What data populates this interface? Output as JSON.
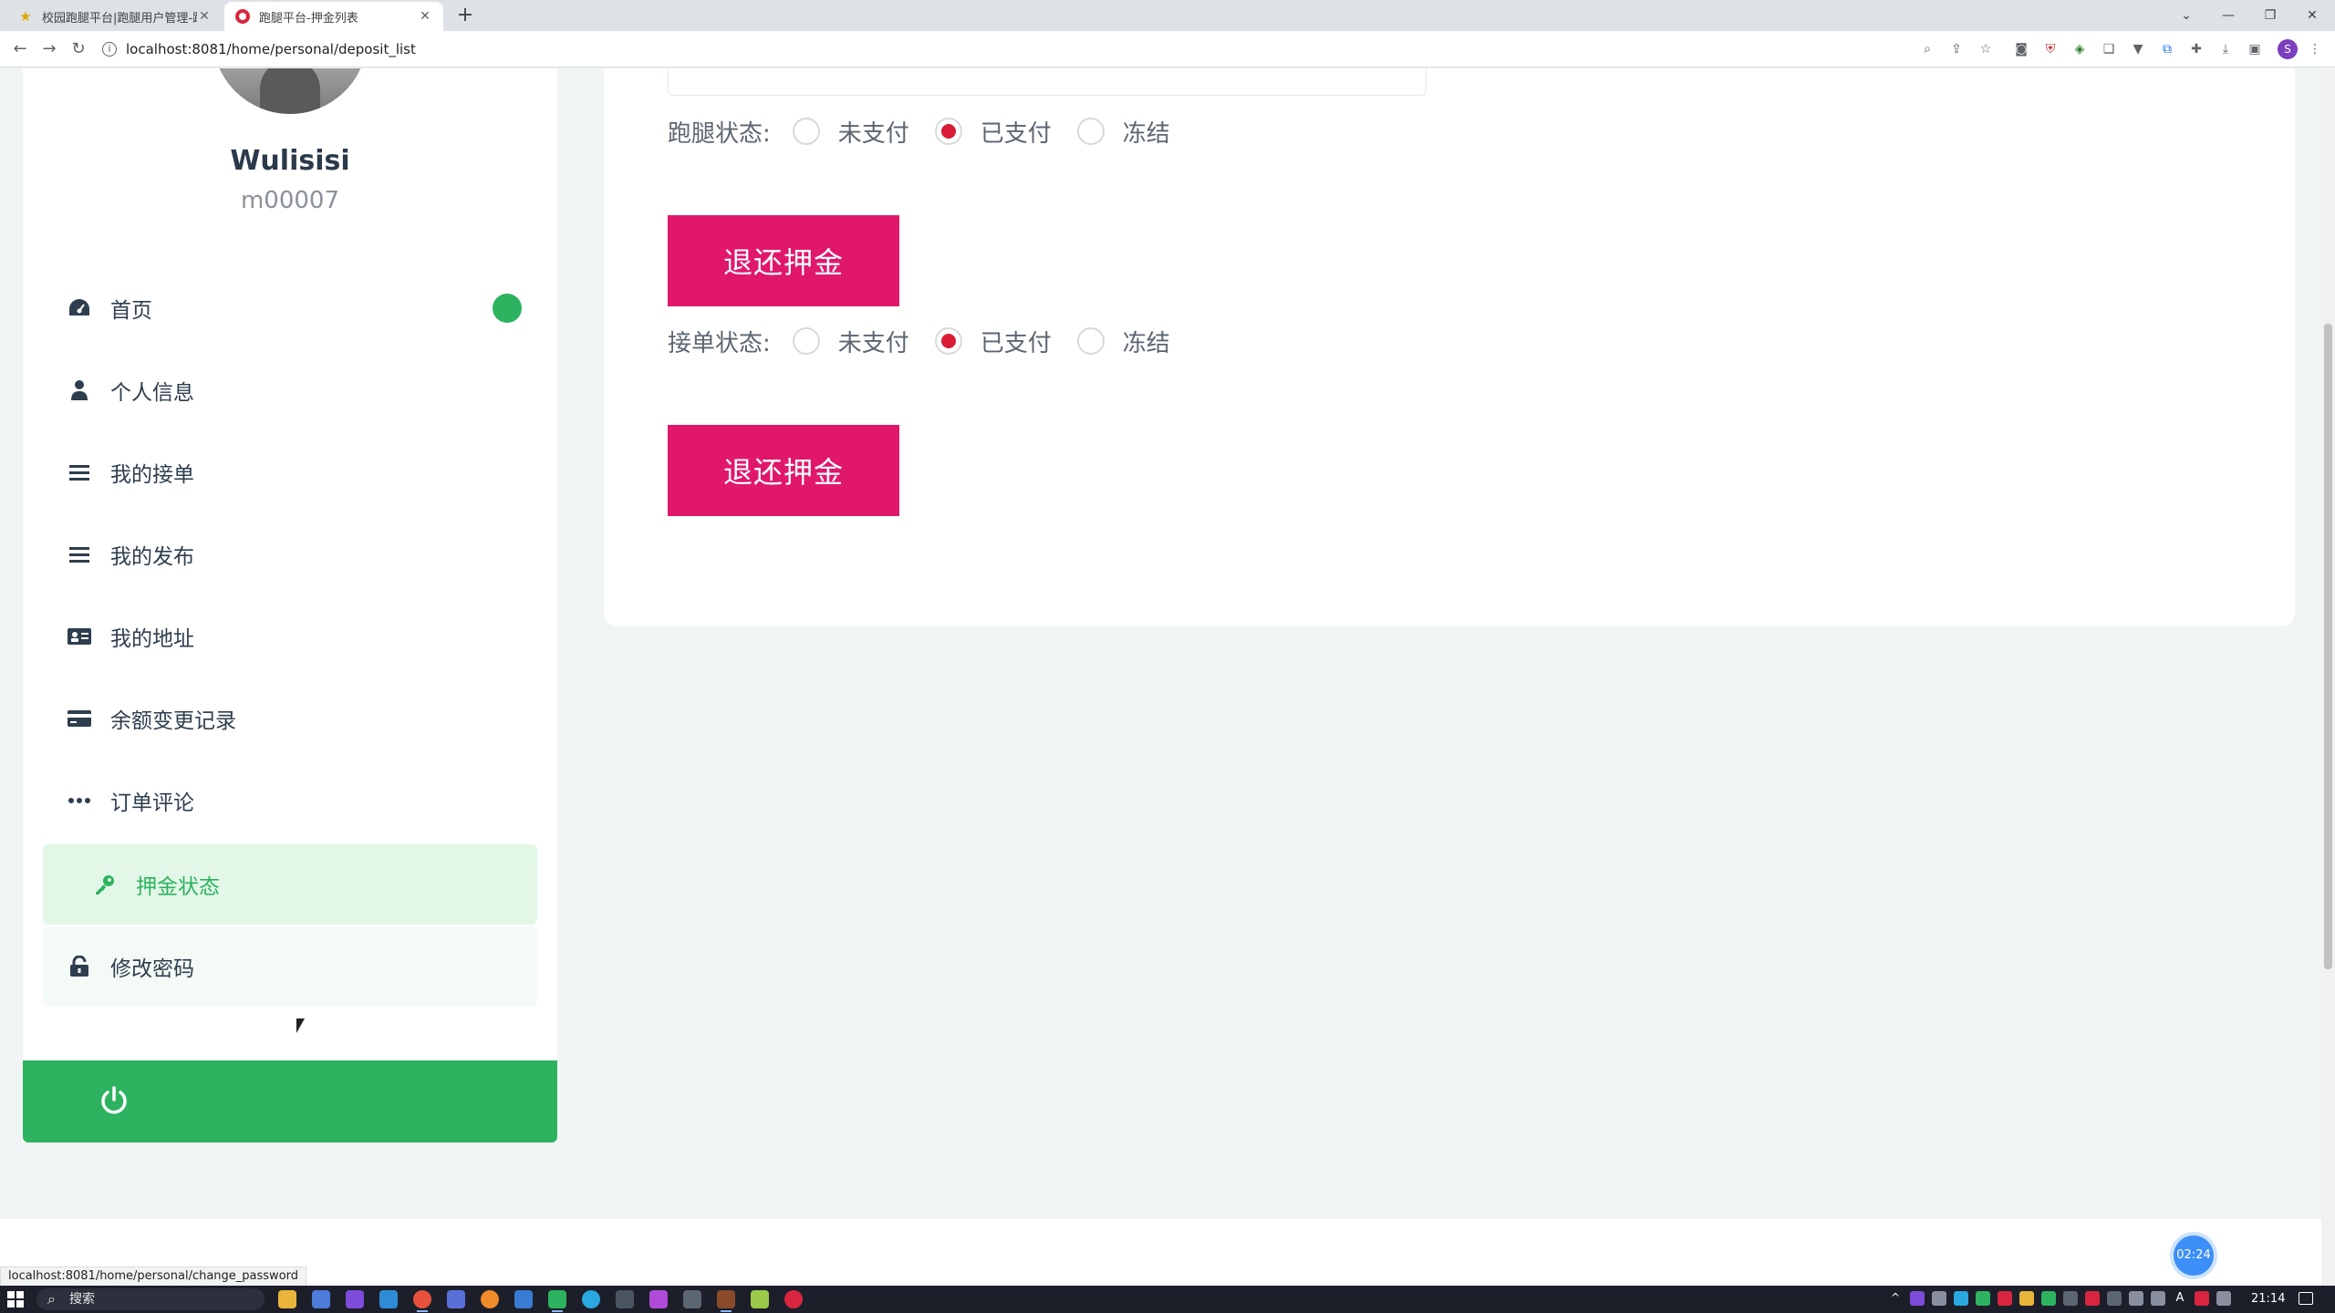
{
  "browser": {
    "tabs": [
      {
        "title": "校园跑腿平台|跑腿用户管理-跑"
      },
      {
        "title": "跑腿平台-押金列表"
      }
    ],
    "url": "localhost:8081/home/personal/deposit_list",
    "status_url": "localhost:8081/home/personal/change_password"
  },
  "profile": {
    "name": "Wulisisi",
    "id": "m00007"
  },
  "menu": {
    "items": [
      {
        "label": "首页",
        "icon": "dashboard-icon"
      },
      {
        "label": "个人信息",
        "icon": "user-icon"
      },
      {
        "label": "我的接单",
        "icon": "list-icon"
      },
      {
        "label": "我的发布",
        "icon": "list-icon"
      },
      {
        "label": "我的地址",
        "icon": "id-card-icon"
      },
      {
        "label": "余额变更记录",
        "icon": "credit-card-icon"
      },
      {
        "label": "订单评论",
        "icon": "ellipsis-icon"
      },
      {
        "label": "押金状态",
        "icon": "key-icon"
      },
      {
        "label": "修改密码",
        "icon": "unlock-icon"
      }
    ],
    "active": "押金状态"
  },
  "deposit": {
    "errand": {
      "label": "跑腿状态:",
      "options": [
        "未支付",
        "已支付",
        "冻结"
      ],
      "selected": "已支付",
      "button": "退还押金"
    },
    "order": {
      "label": "接单状态:",
      "options": [
        "未支付",
        "已支付",
        "冻结"
      ],
      "selected": "已支付",
      "button": "退还押金"
    }
  },
  "overlay": {
    "timer": "02:24"
  },
  "taskbar": {
    "search_placeholder": "搜索",
    "time": "21:14"
  },
  "colors": {
    "accent_green": "#2db35f",
    "button_pink": "#e0176a",
    "radio_red": "#d81c35"
  }
}
